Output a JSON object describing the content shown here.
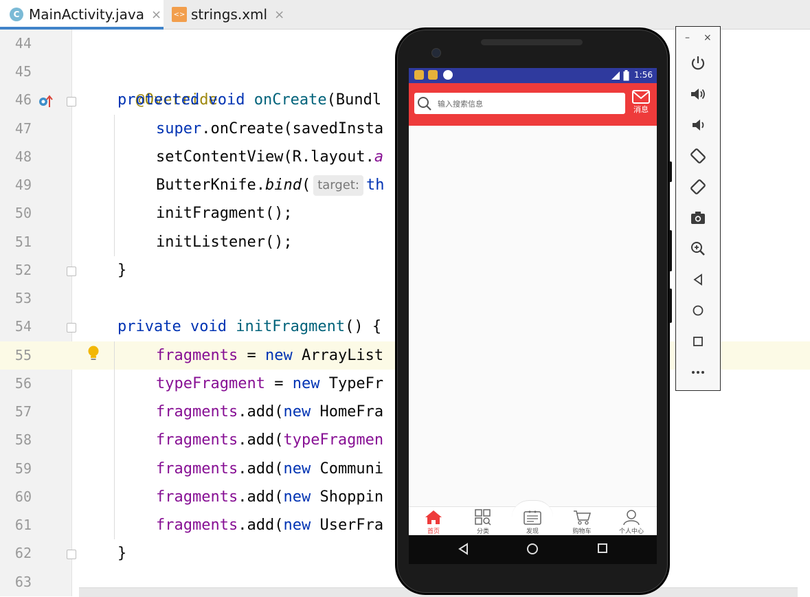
{
  "tabs": [
    {
      "label": "MainActivity.java",
      "icon": "java-class-icon",
      "icon_glyph": "C",
      "active": true
    },
    {
      "label": "strings.xml",
      "icon": "xml-file-icon",
      "icon_glyph": "<>",
      "active": false
    }
  ],
  "tab_close_glyph": "×",
  "editor": {
    "line_numbers": [
      "44",
      "45",
      "46",
      "47",
      "48",
      "49",
      "50",
      "51",
      "52",
      "53",
      "54",
      "55",
      "56",
      "57",
      "58",
      "59",
      "60",
      "61",
      "62",
      "63"
    ],
    "current_line": "55",
    "lines": {
      "l45": {
        "ann": "@Override"
      },
      "l46": {
        "kw1": "protected",
        "kw2": "void",
        "fn": "onCreate",
        "rest": "(Bundl"
      },
      "l47": {
        "kw": "super",
        "rest": ".onCreate(savedInsta"
      },
      "l48": {
        "a": "setContentView(R.layout.",
        "b": "a"
      },
      "l49": {
        "a": "ButterKnife.",
        "b": "bind",
        "c": "(",
        "hint": "target:",
        "d": "th"
      },
      "l50": {
        "a": "initFragment();"
      },
      "l51": {
        "a": "initListener();"
      },
      "l52": {
        "a": "}"
      },
      "l54": {
        "kw1": "private",
        "kw2": "void",
        "fn": "initFragment",
        "rest": "() {"
      },
      "l55": {
        "field": "fragments",
        "op": " = ",
        "kw": "new",
        "rest": " ArrayList"
      },
      "l56": {
        "field": "typeFragment",
        "op": " = ",
        "kw": "new",
        "rest": " TypeFr"
      },
      "l57": {
        "field": "fragments",
        "a": ".add(",
        "kw": "new",
        "rest": " HomeFra"
      },
      "l58": {
        "field": "fragments",
        "a": ".add(",
        "field2": "typeFragmen"
      },
      "l59": {
        "field": "fragments",
        "a": ".add(",
        "kw": "new",
        "rest": " Communi"
      },
      "l60": {
        "field": "fragments",
        "a": ".add(",
        "kw": "new",
        "rest": " Shoppin"
      },
      "l61": {
        "field": "fragments",
        "a": ".add(",
        "kw": "new",
        "rest": " UserFra"
      },
      "l62": {
        "a": "}"
      }
    }
  },
  "phone": {
    "status_time": "1:56",
    "search_placeholder": "输入搜索信息",
    "message_label": "消息",
    "bottom_nav": [
      {
        "label": "首页",
        "icon": "home-icon",
        "active": true
      },
      {
        "label": "分类",
        "icon": "category-grid-icon",
        "active": false
      },
      {
        "label": "发现",
        "icon": "discover-icon",
        "active": false
      },
      {
        "label": "购物车",
        "icon": "cart-icon",
        "active": false
      },
      {
        "label": "个人中心",
        "icon": "user-icon",
        "active": false
      }
    ],
    "colors": {
      "status_bar": "#2f3a9e",
      "header": "#ee3b3b",
      "accent": "#ee3b3b"
    }
  },
  "emulator_toolbar": {
    "minimize": "–",
    "close": "×",
    "tools": [
      "power-icon",
      "volume-up-icon",
      "volume-down-icon",
      "rotate-left-icon",
      "rotate-right-icon",
      "screenshot-icon",
      "zoom-icon",
      "back-icon",
      "home-icon",
      "overview-icon",
      "more-icon"
    ]
  }
}
